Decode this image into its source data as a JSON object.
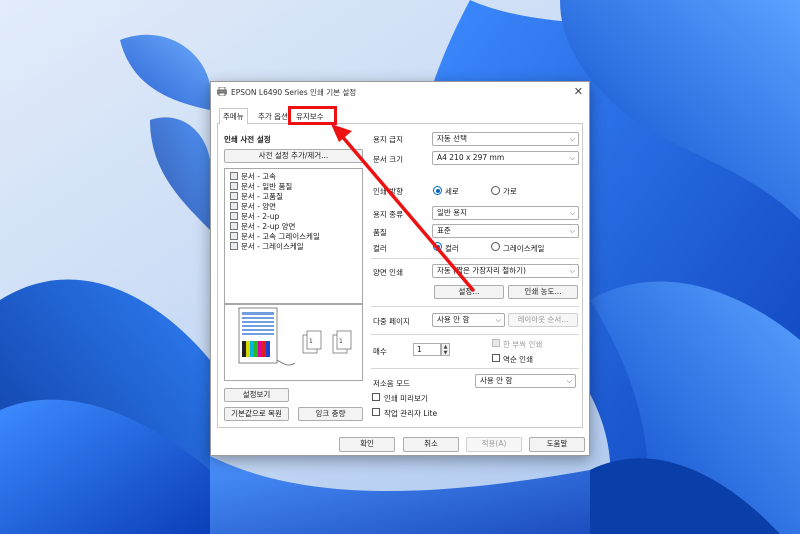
{
  "window": {
    "title": "EPSON L6490 Series 인쇄 기본 설정",
    "close_glyph": "✕"
  },
  "tabs": [
    {
      "label": "주메뉴",
      "active": true
    },
    {
      "label": "추가 옵션",
      "active": false
    },
    {
      "label": "유지보수",
      "active": false,
      "highlighted": true
    }
  ],
  "left": {
    "preset_heading": "인쇄 사전 설정",
    "add_remove_button": "사전 설정 추가/제거...",
    "presets": [
      "문서 - 고속",
      "문서 - 일반 품질",
      "문서 - 고품질",
      "문서 - 양면",
      "문서 - 2-up",
      "문서 - 2-up 양면",
      "문서 - 고속 그레이스케일",
      "문서 - 그레이스케일"
    ],
    "show_settings_button": "설정보기",
    "restore_defaults_button": "기본값으로 복원",
    "ink_levels_button": "잉크 충량"
  },
  "right": {
    "paper_source_label": "용지 급지",
    "paper_source_value": "자동 선택",
    "paper_size_label": "문서 크기",
    "paper_size_value": "A4 210 x 297 mm",
    "orientation_label": "인쇄 방향",
    "orientation_portrait": "세로",
    "orientation_landscape": "가로",
    "paper_type_label": "용지 종류",
    "paper_type_value": "일반 용지",
    "quality_label": "품질",
    "quality_value": "표준",
    "color_label": "컬러",
    "color_option": "컬러",
    "grayscale_option": "그레이스케일",
    "duplex_label": "양면 인쇄",
    "duplex_value": "자동 (짧은 가장자리 철하기)",
    "settings_button": "설정...",
    "print_density_button": "인쇄 농도...",
    "multipage_label": "다중 페이지",
    "multipage_value": "사용 안 함",
    "layout_order_button": "레이아웃 순서...",
    "copies_label": "매수",
    "copies_value": "1",
    "collate_label": "한 부씩 인쇄",
    "reverse_label": "역순 인쇄",
    "quiet_mode_label": "저소음 모드",
    "quiet_mode_value": "사용 안 함",
    "print_preview_label": "인쇄 미리보기",
    "job_arranger_label": "작업 관리자 Lite"
  },
  "footer": {
    "ok": "확인",
    "cancel": "취소",
    "apply": "적용(A)",
    "help": "도움말"
  },
  "colors": {
    "accent_blue": "#0067c0",
    "annotation_red": "#ee1111",
    "wallpaper_blue": "#1565e0"
  },
  "icons": [
    "printer-icon",
    "close-icon",
    "chevron-down-icon",
    "annotation-arrow"
  ]
}
